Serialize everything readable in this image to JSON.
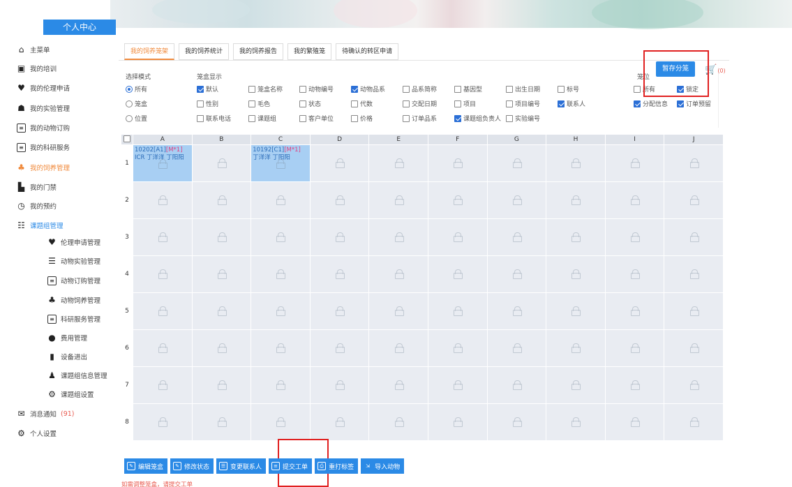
{
  "sidebar": {
    "title": "个人中心",
    "items": [
      {
        "label": "主菜单",
        "icon": "home-icon"
      },
      {
        "label": "我的培训",
        "icon": "training-icon"
      },
      {
        "label": "我的伦理申请",
        "icon": "heart-hand-icon"
      },
      {
        "label": "我的实验管理",
        "icon": "people-icon"
      },
      {
        "label": "我的动物订购",
        "icon": "list-icon"
      },
      {
        "label": "我的科研服务",
        "icon": "list-icon"
      },
      {
        "label": "我的饲养管理",
        "icon": "feed-icon"
      },
      {
        "label": "我的门禁",
        "icon": "building-icon"
      },
      {
        "label": "我的预约",
        "icon": "clock-icon"
      },
      {
        "label": "课题组管理",
        "icon": "group-icon"
      }
    ],
    "subitems": [
      {
        "label": "伦理申请管理",
        "icon": "heart-hand-icon"
      },
      {
        "label": "动物实验管理",
        "icon": "bars-icon"
      },
      {
        "label": "动物订购管理",
        "icon": "list-icon"
      },
      {
        "label": "动物饲养管理",
        "icon": "feed-icon"
      },
      {
        "label": "科研服务管理",
        "icon": "list-icon"
      },
      {
        "label": "费用管理",
        "icon": "money-icon"
      },
      {
        "label": "设备进出",
        "icon": "door-icon"
      },
      {
        "label": "课题组信息管理",
        "icon": "user-icon"
      },
      {
        "label": "课题组设置",
        "icon": "settings-icon"
      }
    ],
    "messages": {
      "label": "消息通知",
      "count": "(91)"
    },
    "personal": {
      "label": "个人设置"
    }
  },
  "tabs": [
    "我的饲养笼架",
    "我的饲养统计",
    "我的饲养报告",
    "我的繁殖笼",
    "待确认的转区申请"
  ],
  "options": {
    "mode_label": "选择模式",
    "modes": [
      {
        "label": "所有",
        "checked": true
      },
      {
        "label": "笼盒",
        "checked": false
      },
      {
        "label": "位置",
        "checked": false
      }
    ],
    "display_label": "笼盒显示",
    "display": [
      {
        "label": "默认",
        "checked": true
      },
      {
        "label": "笼盒名称",
        "checked": false
      },
      {
        "label": "动物编号",
        "checked": false
      },
      {
        "label": "动物品系",
        "checked": true
      },
      {
        "label": "品系简称",
        "checked": false
      },
      {
        "label": "基因型",
        "checked": false
      },
      {
        "label": "出生日期",
        "checked": false
      },
      {
        "label": "标号",
        "checked": false
      },
      {
        "label": "性别",
        "checked": false
      },
      {
        "label": "毛色",
        "checked": false
      },
      {
        "label": "状态",
        "checked": false
      },
      {
        "label": "代数",
        "checked": false
      },
      {
        "label": "交配日期",
        "checked": false
      },
      {
        "label": "项目",
        "checked": false
      },
      {
        "label": "项目编号",
        "checked": false
      },
      {
        "label": "联系人",
        "checked": true
      },
      {
        "label": "联系电话",
        "checked": false
      },
      {
        "label": "课题组",
        "checked": false
      },
      {
        "label": "客户单位",
        "checked": false
      },
      {
        "label": "价格",
        "checked": false
      },
      {
        "label": "订单品系",
        "checked": false
      },
      {
        "label": "课题组负责人",
        "checked": true
      },
      {
        "label": "实验编号",
        "checked": false
      }
    ],
    "slot_label": "笼位",
    "slot": [
      {
        "label": "所有",
        "checked": false
      },
      {
        "label": "锁定",
        "checked": true
      },
      {
        "label": "分配信息",
        "checked": true
      },
      {
        "label": "订单预留",
        "checked": true
      }
    ],
    "temp_button": "暂存分笼",
    "cart_count": "(0)"
  },
  "grid": {
    "columns": [
      "A",
      "B",
      "C",
      "D",
      "E",
      "F",
      "G",
      "H",
      "I",
      "J"
    ],
    "rows": [
      "1",
      "2",
      "3",
      "4",
      "5",
      "6",
      "7",
      "8"
    ],
    "cells": {
      "A1": {
        "code": "10202[A1]",
        "tag": "[M*1]",
        "line2": "ICR 丁洋洋 丁阳阳"
      },
      "C1": {
        "code": "10192[C1]",
        "tag": "[M*1]",
        "line2": "丁洋洋 丁阳阳"
      }
    }
  },
  "actions": [
    "编辑笼盒",
    "修改状态",
    "变更联系人",
    "提交工单",
    "重打标签",
    "导入动物"
  ],
  "hint": "如需调整笼盒，请提交工单",
  "colors": {
    "accent": "#2b8ae6",
    "active_tab": "#f08a3c",
    "selected_cell": "#a8cff3",
    "highlight_box": "#e02020"
  }
}
